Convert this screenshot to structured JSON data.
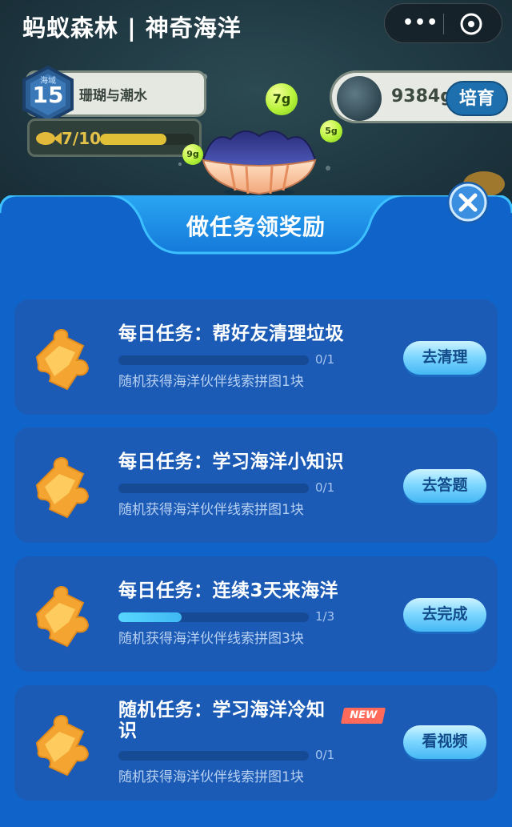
{
  "app": {
    "title": "蚂蚁森林 | 神奇海洋",
    "more_label": "•••"
  },
  "game": {
    "level_small_label": "海域",
    "level": "15",
    "ocean_name": "珊瑚与潮水",
    "fish_count": "7/10",
    "fish_progress": 0.7,
    "grams": "9384g",
    "grow_button": "培育",
    "bubbles": [
      "7g",
      "5g",
      "9g"
    ]
  },
  "modal": {
    "title": "做任务领奖励",
    "tasks": [
      {
        "title": "每日任务：帮好友清理垃圾",
        "progress_text": "0/1",
        "progress": 0,
        "reward": "随机获得海洋伙伴线索拼图1块",
        "button": "去清理",
        "is_new": false
      },
      {
        "title": "每日任务：学习海洋小知识",
        "progress_text": "0/1",
        "progress": 0,
        "reward": "随机获得海洋伙伴线索拼图1块",
        "button": "去答题",
        "is_new": false
      },
      {
        "title": "每日任务：连续3天来海洋",
        "progress_text": "1/3",
        "progress": 0.333,
        "reward": "随机获得海洋伙伴线索拼图3块",
        "button": "去完成",
        "is_new": false
      },
      {
        "title": "随机任务：学习海洋冷知识",
        "progress_text": "0/1",
        "progress": 0,
        "reward": "随机获得海洋伙伴线索拼图1块",
        "button": "看视频",
        "is_new": true,
        "new_label": "NEW"
      }
    ]
  },
  "colors": {
    "modal_bg": "#0f63c9",
    "card_bg": "#1b5bb6",
    "button_text": "#134a8a",
    "progress_fill": "#57d7ff",
    "new_badge": "#ff6a5a"
  }
}
